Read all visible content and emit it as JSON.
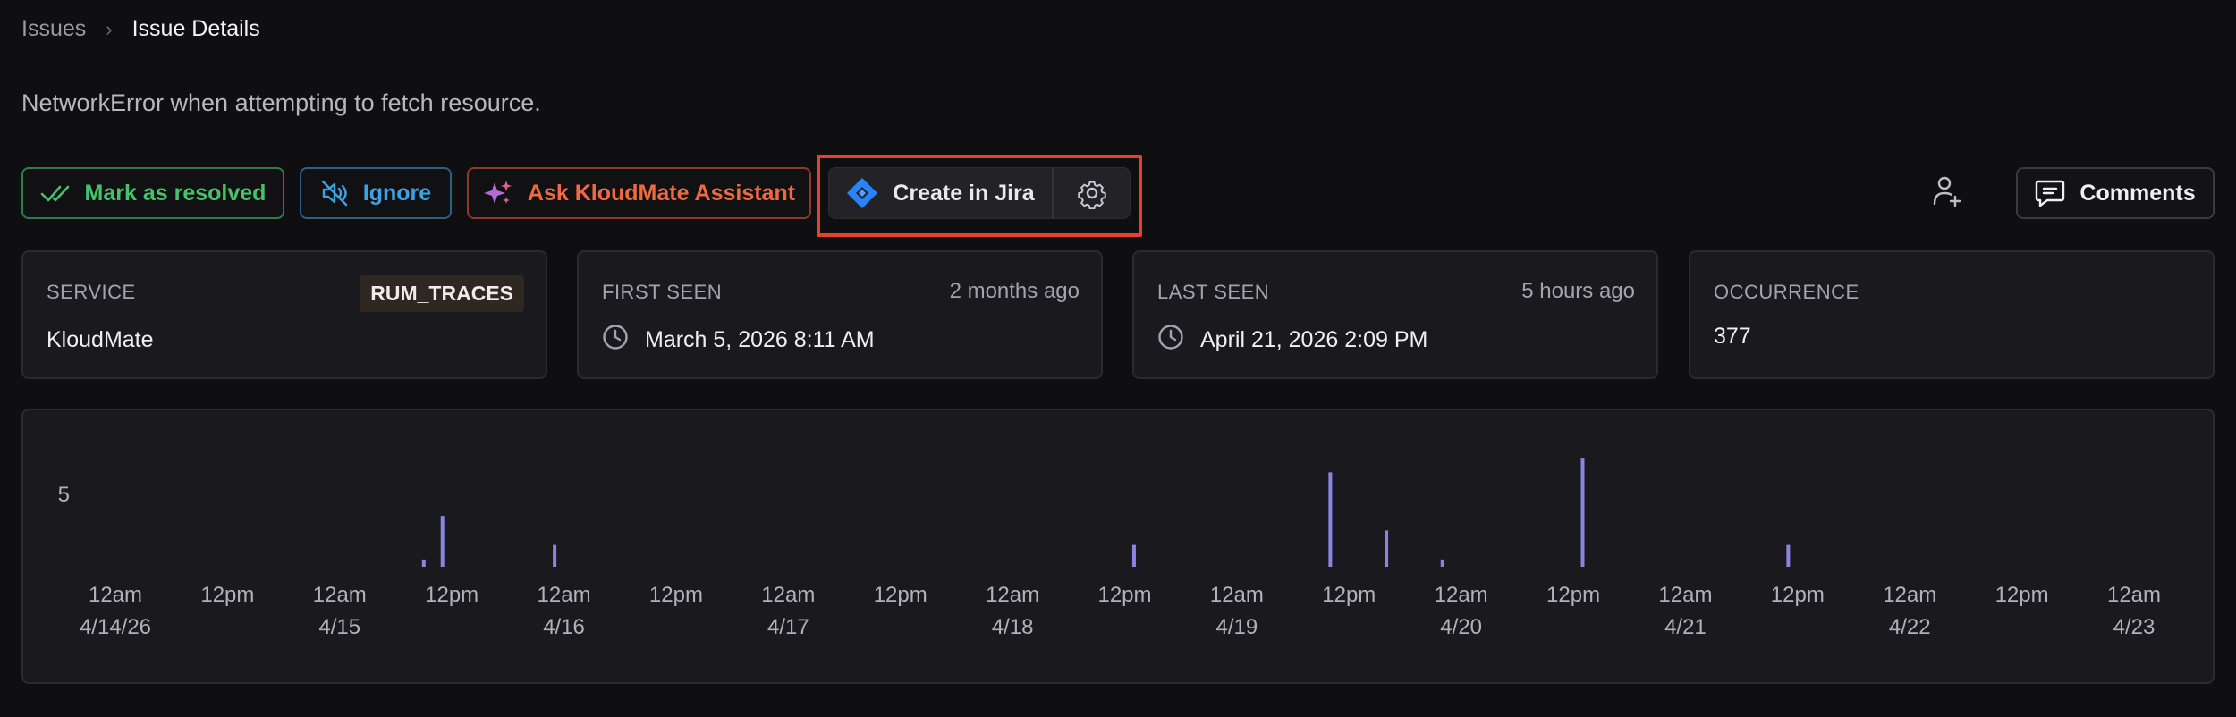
{
  "breadcrumb": {
    "root": "Issues",
    "separator": "›",
    "current": "Issue Details"
  },
  "issue": {
    "title": "NetworkError when attempting to fetch resource."
  },
  "actions": {
    "resolve_label": "Mark as resolved",
    "ignore_label": "Ignore",
    "ask_label": "Ask KloudMate Assistant",
    "jira_label": "Create in Jira",
    "comments_label": "Comments",
    "colors": {
      "resolve": "#47c26b",
      "ignore": "#3da2e3",
      "ask": "#ef6a3f",
      "jira": "#2684ff",
      "highlight": "#e5412d"
    }
  },
  "cards": {
    "service": {
      "label": "SERVICE",
      "badge": "RUM_TRACES",
      "value": "KloudMate"
    },
    "first_seen": {
      "label": "FIRST SEEN",
      "relative": "2 months ago",
      "value": "March 5, 2026 8:11 AM",
      "icon": "clock-icon"
    },
    "last_seen": {
      "label": "LAST SEEN",
      "relative": "5 hours ago",
      "value": "April 21, 2026 2:09 PM",
      "icon": "clock-icon"
    },
    "occurrence": {
      "label": "OCCURRENCE",
      "value": "377"
    }
  },
  "chart_data": {
    "type": "bar",
    "bar_color": "#8b84e0",
    "y_ticks": [
      5
    ],
    "ylim": [
      0,
      8
    ],
    "x_ticks": [
      {
        "time": "12am",
        "date": "4/14/26"
      },
      {
        "time": "12pm",
        "date": ""
      },
      {
        "time": "12am",
        "date": "4/15"
      },
      {
        "time": "12pm",
        "date": ""
      },
      {
        "time": "12am",
        "date": "4/16"
      },
      {
        "time": "12pm",
        "date": ""
      },
      {
        "time": "12am",
        "date": "4/17"
      },
      {
        "time": "12pm",
        "date": ""
      },
      {
        "time": "12am",
        "date": "4/18"
      },
      {
        "time": "12pm",
        "date": ""
      },
      {
        "time": "12am",
        "date": "4/19"
      },
      {
        "time": "12pm",
        "date": ""
      },
      {
        "time": "12am",
        "date": "4/20"
      },
      {
        "time": "12pm",
        "date": ""
      },
      {
        "time": "12am",
        "date": "4/21"
      },
      {
        "time": "12pm",
        "date": ""
      },
      {
        "time": "12am",
        "date": "4/22"
      },
      {
        "time": "12pm",
        "date": ""
      },
      {
        "time": "12am",
        "date": "4/23"
      }
    ],
    "bars": [
      {
        "x": "2026-04-15 09:00",
        "value": 0.5
      },
      {
        "x": "2026-04-15 11:00",
        "value": 3.5
      },
      {
        "x": "2026-04-15 23:00",
        "value": 1.5
      },
      {
        "x": "2026-04-18 13:00",
        "value": 1.5
      },
      {
        "x": "2026-04-19 10:00",
        "value": 6.5
      },
      {
        "x": "2026-04-19 16:00",
        "value": 2.5
      },
      {
        "x": "2026-04-19 22:00",
        "value": 0.5
      },
      {
        "x": "2026-04-20 13:00",
        "value": 7.5
      },
      {
        "x": "2026-04-21 11:00",
        "value": 1.5
      }
    ]
  }
}
